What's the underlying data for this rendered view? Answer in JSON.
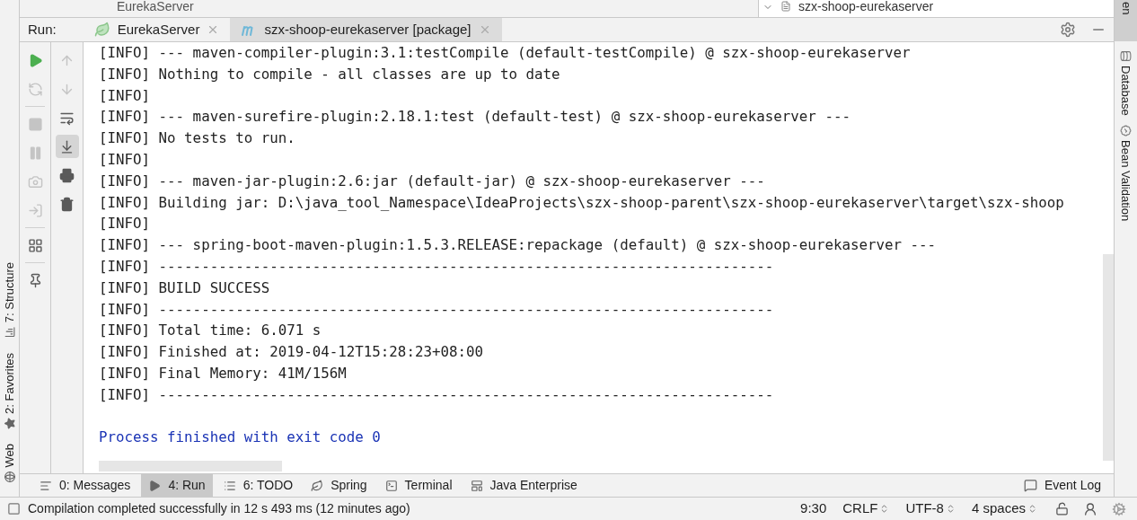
{
  "top_strip": {
    "left_title": "EurekaServer",
    "tree_item": "szx-shoop-eurekaserver",
    "edge_label": "en"
  },
  "left_sidebar": [
    {
      "label": "7: Structure"
    },
    {
      "label": "2: Favorites"
    },
    {
      "label": "Web"
    }
  ],
  "right_sidebar": [
    {
      "label": "Database"
    },
    {
      "label": "Bean Validation"
    }
  ],
  "run_header": {
    "label": "Run:",
    "tabs": [
      {
        "label": "EurekaServer",
        "selected": false
      },
      {
        "label": "szx-shoop-eurekaserver [package]",
        "selected": true
      }
    ]
  },
  "run_toolbar": [
    {
      "disabled": false,
      "selected": false
    },
    {
      "disabled": true,
      "selected": false
    },
    {
      "disabled": true,
      "selected": false
    },
    {
      "disabled": true,
      "selected": false
    },
    {
      "disabled": true,
      "selected": false
    },
    {
      "disabled": true,
      "selected": false
    },
    {
      "disabled": false,
      "selected": false
    },
    {
      "disabled": false,
      "selected": false
    }
  ],
  "console_toolbar": [
    {
      "disabled": true,
      "selected": false
    },
    {
      "disabled": true,
      "selected": false
    },
    {
      "disabled": false,
      "selected": false
    },
    {
      "disabled": false,
      "selected": true
    },
    {
      "disabled": false,
      "selected": false
    },
    {
      "disabled": false,
      "selected": false
    }
  ],
  "console": [
    {
      "kind": "log",
      "text": "[INFO] --- maven-compiler-plugin:3.1:testCompile (default-testCompile) @ szx-shoop-eurekaserver"
    },
    {
      "kind": "log",
      "text": "[INFO] Nothing to compile - all classes are up to date"
    },
    {
      "kind": "log",
      "text": "[INFO]"
    },
    {
      "kind": "log",
      "text": "[INFO] --- maven-surefire-plugin:2.18.1:test (default-test) @ szx-shoop-eurekaserver ---"
    },
    {
      "kind": "log",
      "text": "[INFO] No tests to run."
    },
    {
      "kind": "log",
      "text": "[INFO]"
    },
    {
      "kind": "log",
      "text": "[INFO] --- maven-jar-plugin:2.6:jar (default-jar) @ szx-shoop-eurekaserver ---"
    },
    {
      "kind": "log",
      "text": "[INFO] Building jar: D:\\java_tool_Namespace\\IdeaProjects\\szx-shoop-parent\\szx-shoop-eurekaserver\\target\\szx-shoop"
    },
    {
      "kind": "log",
      "text": "[INFO]"
    },
    {
      "kind": "log",
      "text": "[INFO] --- spring-boot-maven-plugin:1.5.3.RELEASE:repackage (default) @ szx-shoop-eurekaserver ---"
    },
    {
      "kind": "log",
      "text": "[INFO] ------------------------------------------------------------------------"
    },
    {
      "kind": "log",
      "text": "[INFO] BUILD SUCCESS"
    },
    {
      "kind": "log",
      "text": "[INFO] ------------------------------------------------------------------------"
    },
    {
      "kind": "log",
      "text": "[INFO] Total time: 6.071 s"
    },
    {
      "kind": "log",
      "text": "[INFO] Finished at: 2019-04-12T15:28:23+08:00"
    },
    {
      "kind": "log",
      "text": "[INFO] Final Memory: 41M/156M"
    },
    {
      "kind": "log",
      "text": "[INFO] ------------------------------------------------------------------------"
    },
    {
      "kind": "blank"
    },
    {
      "kind": "process",
      "text": "Process finished with exit code 0"
    }
  ],
  "tool_tabs": [
    {
      "label": "0: Messages",
      "selected": false
    },
    {
      "label": "4: Run",
      "selected": true
    },
    {
      "label": "6: TODO",
      "selected": false
    },
    {
      "label": "Spring",
      "selected": false
    },
    {
      "label": "Terminal",
      "selected": false
    },
    {
      "label": "Java Enterprise",
      "selected": false
    }
  ],
  "event_log": "Event Log",
  "status_bar": {
    "message": "Compilation completed successfully in 12 s 493 ms (12 minutes ago)",
    "items": [
      {
        "kind": "plain",
        "text": "9:30"
      },
      {
        "kind": "dropdown",
        "text": "CRLF"
      },
      {
        "kind": "dropdown",
        "text": "UTF-8"
      },
      {
        "kind": "dropdown",
        "text": "4 spaces"
      }
    ]
  }
}
